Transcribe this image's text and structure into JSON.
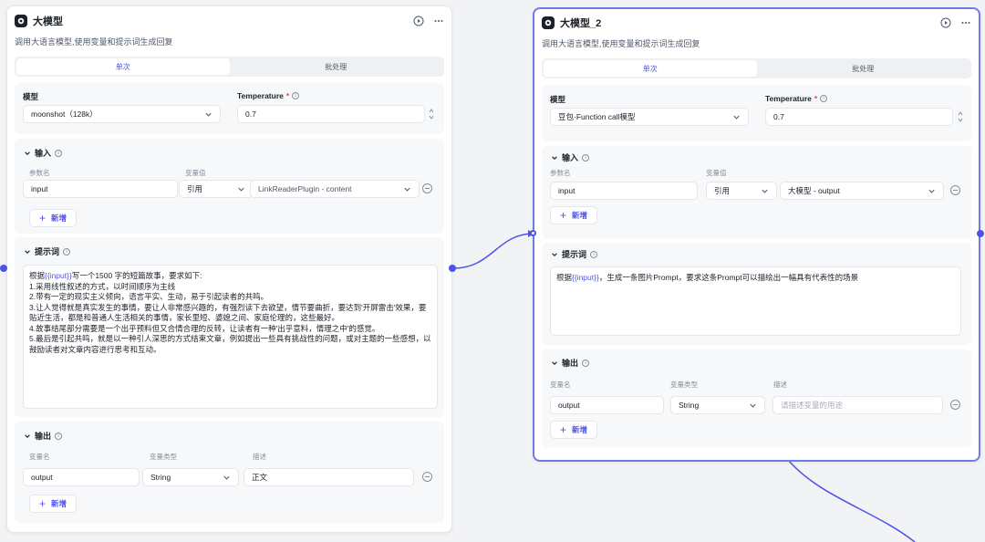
{
  "node1": {
    "title": "大模型",
    "description": "调用大语言模型,使用变量和提示词生成回复",
    "tabs": [
      "单次",
      "批处理"
    ],
    "model_label": "模型",
    "model_value": "moonshot（128k）",
    "temp_label": "Temperature",
    "temp_value": "0.7",
    "input_title": "输入",
    "param_name_label": "参数名",
    "param_value_label": "变量值",
    "input_name": "input",
    "input_type": "引用",
    "input_ref": "LinkReaderPlugin - content",
    "add_label": "新增",
    "prompt_title": "提示词",
    "prompt_pre": "根据",
    "prompt_var": "{{input}}",
    "prompt_post": "写一个1500 字的短篇故事，要求如下:\n1.采用线性叙述的方式，以时间顺序为主线\n2.带有一定的现实主义倾向，语言平实、生动，易于引起读者的共鸣。\n3.让人觉得就是真实发生的事情，要让人非常感兴趣的，有强烈读下去欲望，情节要曲折，要达到'开屏雷击'效果，要贴近生活，都是和普通人生活相关的事情，家长里短、婆媳之间、家庭伦理的，这些最好。\n4.故事结尾部分需要是一个出乎预料但又合情合理的反转，让读者有一种'出乎意料，情理之中'的感觉。\n5.最后是引起共鸣，就是以一种引人深思的方式结束文章，例如提出一些具有挑战性的问题，或对主题的一些感想，以鼓励读者对文章内容进行思考和互动。",
    "output_title": "输出",
    "out_name_label": "变量名",
    "out_type_label": "变量类型",
    "out_desc_label": "描述",
    "output_name": "output",
    "output_type": "String",
    "output_desc": "正文"
  },
  "node2": {
    "title": "大模型_2",
    "description": "调用大语言模型,使用变量和提示词生成回复",
    "tabs": [
      "单次",
      "批处理"
    ],
    "model_label": "模型",
    "model_value": "豆包·Function call模型",
    "temp_label": "Temperature",
    "temp_value": "0.7",
    "input_title": "输入",
    "param_name_label": "参数名",
    "param_value_label": "变量值",
    "input_name": "input",
    "input_type": "引用",
    "input_ref": "大模型 - output",
    "add_label": "新增",
    "prompt_title": "提示词",
    "prompt_pre": "根据",
    "prompt_var": "{{input}}",
    "prompt_post": "，生成一条图片Prompt，要求这条Prompt可以描绘出一幅具有代表性的场景",
    "output_title": "输出",
    "out_name_label": "变量名",
    "out_type_label": "变量类型",
    "out_desc_label": "描述",
    "output_name": "output",
    "output_type": "String",
    "output_desc_placeholder": "请描述变量的用途"
  },
  "icons": [
    "model-logo-icon",
    "run-icon",
    "more-icon",
    "chevron-down-icon",
    "info-icon",
    "plus-icon",
    "remove-icon"
  ],
  "colors": {
    "accent": "#4d53e8",
    "selected_border": "#6c7ce6",
    "required": "#f53f3f"
  }
}
